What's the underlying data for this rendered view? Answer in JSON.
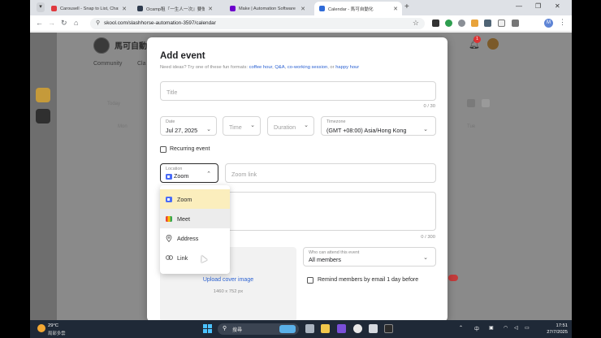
{
  "browser": {
    "tabs": [
      {
        "title": "Carousell - Snap to List, Chat",
        "favicon_color": "#e0393e"
      },
      {
        "title": "Ocamp租『一生人一次』要做",
        "favicon_color": "#2e3b4e"
      },
      {
        "title": "Make | Automation Software",
        "favicon_color": "#6d00cc"
      },
      {
        "title": "Calendar - 馬可自動化",
        "favicon_color": "#2f6bd8"
      }
    ],
    "url": "skool.com/slashhorse-automation-3597/calendar",
    "profile_initial": "M"
  },
  "site": {
    "name": "馬可自動化",
    "nav": [
      "Community",
      "Cla"
    ],
    "ghost_labels": [
      "Today",
      "Mon",
      "Tue"
    ],
    "notification_count": "1"
  },
  "modal": {
    "title": "Add event",
    "subtitle_prefix": "Need ideas? Try one of these fun formats:",
    "subtitle_links": [
      "coffee hour",
      "Q&A",
      "co-working session",
      "happy hour"
    ],
    "subtitle_joiners": [
      ", ",
      ", ",
      ", or "
    ],
    "title_placeholder": "Title",
    "title_count": "0 / 30",
    "date_label": "Date",
    "date_value": "Jul 27, 2025",
    "time_placeholder": "Time",
    "duration_placeholder": "Duration",
    "timezone_label": "Timezone",
    "timezone_value": "(GMT +08:00) Asia/Hong Kong",
    "recurring_label": "Recurring event",
    "location_label": "Location",
    "location_value": "Zoom",
    "zoom_link_placeholder": "Zoom link",
    "description_count": "0 / 300",
    "location_options": [
      {
        "label": "Zoom",
        "icon": "zoom-icon",
        "state": "selected"
      },
      {
        "label": "Meet",
        "icon": "google-meet-icon",
        "state": "hover"
      },
      {
        "label": "Address",
        "icon": "map-pin-icon",
        "state": ""
      },
      {
        "label": "Link",
        "icon": "link-icon",
        "state": ""
      }
    ],
    "upload_cover_label": "Upload cover image",
    "cover_size": "1460 x 752 px",
    "attend_label": "Who can attend this event",
    "attend_value": "All members",
    "remind_label": "Remind members by email 1 day before"
  },
  "taskbar": {
    "temperature": "29°C",
    "weather_desc": "局部多雲",
    "search_placeholder": "搜尋",
    "input_method": "中",
    "time": "17:51",
    "date": "27/7/2025"
  },
  "colors": {
    "accent_link": "#2c62d2",
    "dropdown_selected": "#fbeebd",
    "zoom_blue": "#4a6cf7"
  }
}
